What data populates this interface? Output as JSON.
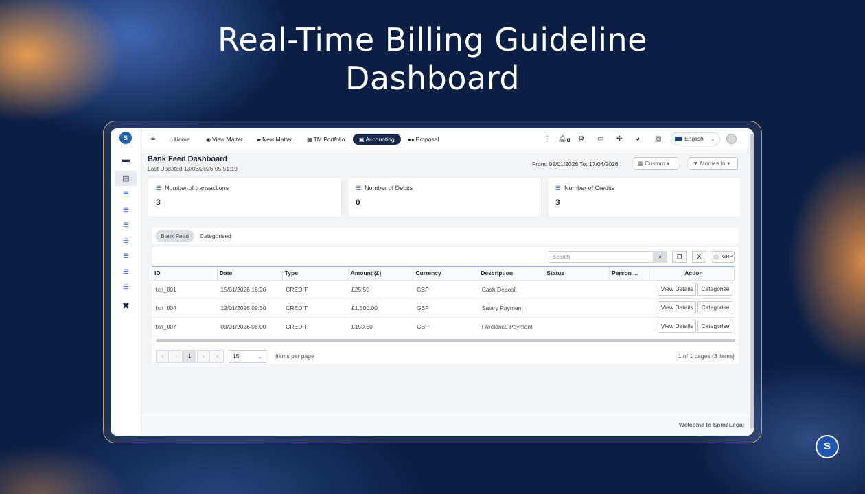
{
  "hero": {
    "line1": "Real-Time Billing Guideline",
    "line2": "Dashboard"
  },
  "brand": {
    "logo_text": "S"
  },
  "sidebar": {
    "items": [
      {
        "icon": "wallet-icon"
      },
      {
        "icon": "document-icon",
        "active": true
      },
      {
        "icon": "list-icon"
      },
      {
        "icon": "list-icon"
      },
      {
        "icon": "list-icon"
      },
      {
        "icon": "list-icon"
      },
      {
        "icon": "list-icon"
      },
      {
        "icon": "list-icon"
      },
      {
        "icon": "list-icon"
      },
      {
        "icon": "tools-icon"
      }
    ]
  },
  "nav": {
    "home": "Home",
    "view_matter": "View Matter",
    "new_matter": "New Matter",
    "tm_portfolio": "TM Portfolio",
    "accounting": "Accounting",
    "proposal": "Proposal",
    "notification_count": "1",
    "language": "English"
  },
  "page": {
    "title": "Bank Feed Dashboard",
    "last_updated": "Last Updated 13/03/2026 05:51:19",
    "date_range": "From: 02/01/2026  To: 17/04/2026",
    "range_select": "Custom",
    "filter": "Monies In"
  },
  "stats": [
    {
      "label": "Number of transactions",
      "value": "3"
    },
    {
      "label": "Number of Debits",
      "value": "0"
    },
    {
      "label": "Number of Credits",
      "value": "3"
    }
  ],
  "tabs": {
    "bank_feed": "Bank Feed",
    "categorised": "Categorised"
  },
  "grid": {
    "search_placeholder": "Search",
    "grp_label": "GRP",
    "columns": [
      "ID",
      "Date",
      "Type",
      "Amount (£)",
      "Currency",
      "Description",
      "Status",
      "Person ...",
      "Action"
    ],
    "rows": [
      {
        "id": "txn_001",
        "date": "15/01/2026 16:20",
        "type": "CREDIT",
        "amount": "£25.50",
        "currency": "GBP",
        "description": "Cash Deposit",
        "status": "",
        "person": ""
      },
      {
        "id": "txn_004",
        "date": "12/01/2026 09:30",
        "type": "CREDIT",
        "amount": "£1,500.00",
        "currency": "GBP",
        "description": "Salary Payment",
        "status": "",
        "person": ""
      },
      {
        "id": "txn_007",
        "date": "09/01/2026 08:00",
        "type": "CREDIT",
        "amount": "£150.60",
        "currency": "GBP",
        "description": "Freelance Payment",
        "status": "",
        "person": ""
      }
    ],
    "view_details_label": "View Details",
    "categorise_label": "Categorise"
  },
  "pager": {
    "first": "«",
    "prev": "‹",
    "current": "1",
    "next": "›",
    "last": "»",
    "page_size": "15",
    "items_per_page": "Items per page",
    "summary": "1 of 1 pages (3 items)"
  },
  "footer": {
    "text": "Welcome to SpineLegal"
  }
}
